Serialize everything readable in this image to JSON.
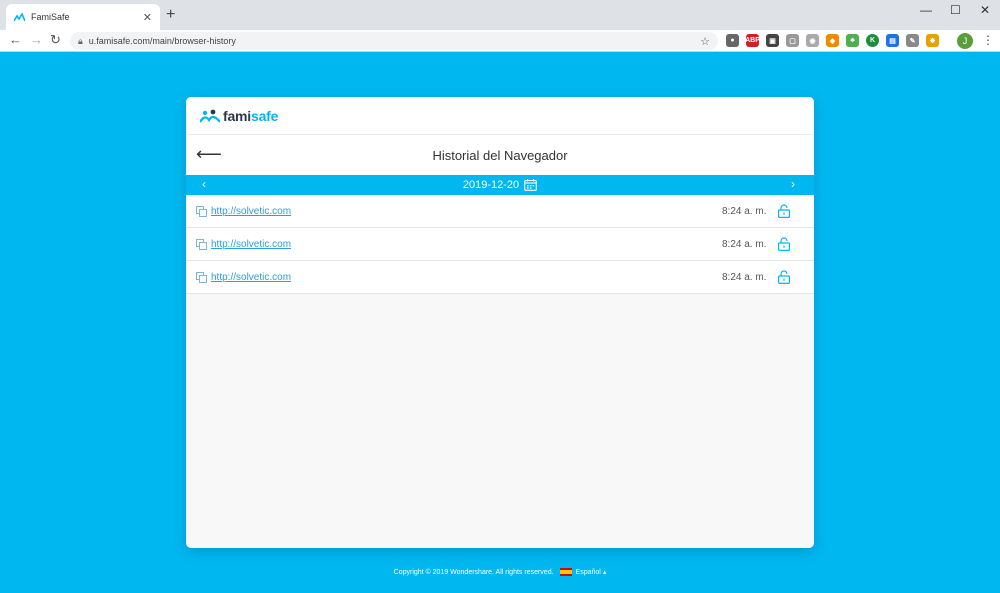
{
  "browser": {
    "tab_title": "FamiSafe",
    "url": "u.famisafe.com/main/browser-history",
    "profile_initial": "J"
  },
  "app": {
    "logo": {
      "part1": "fami",
      "part2": "safe"
    },
    "page_title": "Historial del Navegador",
    "date": "2019-12-20",
    "history": [
      {
        "url": "http://solvetic.com",
        "time": "8:24 a. m."
      },
      {
        "url": "http://solvetic.com",
        "time": "8:24 a. m."
      },
      {
        "url": "http://solvetic.com",
        "time": "8:24 a. m."
      }
    ]
  },
  "footer": {
    "copyright": "Copyright © 2019 Wondershare. All rights reserved.",
    "language": "Español"
  },
  "colors": {
    "accent": "#00b7f0",
    "link": "#2b9fd9"
  }
}
